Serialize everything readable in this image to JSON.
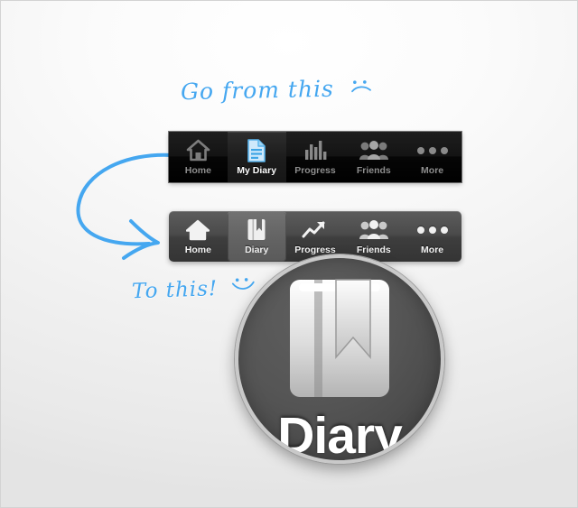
{
  "annotations": {
    "from_text": "Go from this",
    "from_emoticon": "︵",
    "to_text": "To this!",
    "to_emoticon": "‿",
    "arrow": "curved-arrow-down-right",
    "color": "#45a7f0"
  },
  "old_toolbar": {
    "name": "old-tab-bar",
    "style": "black",
    "background_color": "#0a0a0a",
    "selected_index": 1,
    "tabs": [
      {
        "label": "Home",
        "icon": "home-icon",
        "selected": false
      },
      {
        "label": "My Diary",
        "icon": "document-icon",
        "selected": true
      },
      {
        "label": "Progress",
        "icon": "bar-chart-icon",
        "selected": false
      },
      {
        "label": "Friends",
        "icon": "friends-icon",
        "selected": false
      },
      {
        "label": "More",
        "icon": "more-dots-icon",
        "selected": false
      }
    ]
  },
  "new_toolbar": {
    "name": "new-tab-bar",
    "style": "gray",
    "background_color": "#4b4b4b",
    "selected_index": 1,
    "tabs": [
      {
        "label": "Home",
        "icon": "home-icon",
        "selected": false
      },
      {
        "label": "Diary",
        "icon": "book-icon",
        "selected": true
      },
      {
        "label": "Progress",
        "icon": "trending-up-icon",
        "selected": false
      },
      {
        "label": "Friends",
        "icon": "friends-icon",
        "selected": false
      },
      {
        "label": "More",
        "icon": "more-dots-icon",
        "selected": false
      }
    ]
  },
  "magnifier": {
    "name": "zoom-preview",
    "icon": "book-icon",
    "label": "Diary",
    "circle_color": "#4f4f4f",
    "rim_color": "#c9c9c9"
  }
}
